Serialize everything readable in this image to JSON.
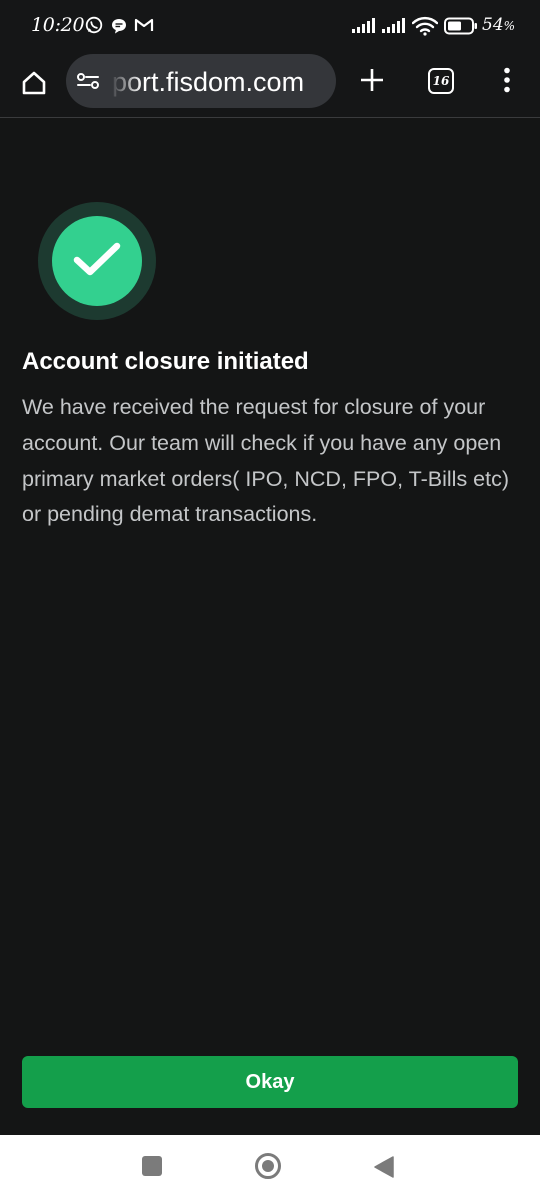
{
  "status_bar": {
    "time": "10:20",
    "notification_icons": [
      "whatsapp-icon",
      "chat-bubble-icon",
      "gmail-icon"
    ],
    "battery_percent": "54",
    "battery_unit": "%"
  },
  "browser": {
    "url": "support.fisdom.com",
    "url_visible": "port.fisdom.com",
    "tab_count": "16"
  },
  "content": {
    "title": "Account closure initiated",
    "message": "We have received the request for closure of your account. Our team will check if you have any open primary market orders( IPO, NCD, FPO, T-Bills etc) or pending demat transactions.",
    "button_label": "Okay"
  },
  "colors": {
    "background": "#141515",
    "success_green": "#33d08f",
    "button_green": "#149f4b"
  }
}
